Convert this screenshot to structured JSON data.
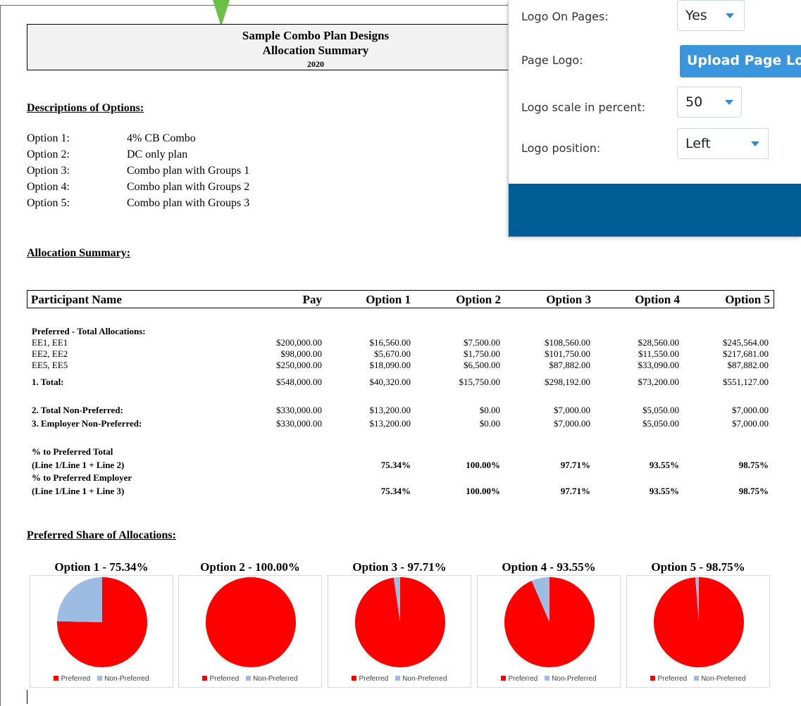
{
  "header": {
    "title": "Sample Combo Plan Designs",
    "subtitle": "Allocation Summary",
    "year": "2020"
  },
  "descriptions": {
    "heading": "Descriptions of Options:",
    "options": [
      {
        "label": "Option 1:",
        "desc": "4% CB Combo"
      },
      {
        "label": "Option 2:",
        "desc": "DC only plan"
      },
      {
        "label": "Option 3:",
        "desc": "Combo plan with Groups 1"
      },
      {
        "label": "Option 4:",
        "desc": "Combo plan with Groups 2"
      },
      {
        "label": "Option 5:",
        "desc": "Combo plan with Groups 3"
      }
    ]
  },
  "allocation": {
    "heading": "Allocation Summary:",
    "columns": [
      "Participant Name",
      "Pay",
      "Option 1",
      "Option 2",
      "Option 3",
      "Option 4",
      "Option 5"
    ],
    "preferred_label": "Preferred - Total Allocations:",
    "rows": [
      {
        "name": "EE1, EE1",
        "values": [
          "$200,000.00",
          "$16,560.00",
          "$7,500.00",
          "$108,560.00",
          "$28,560.00",
          "$245,564.00"
        ]
      },
      {
        "name": "EE2, EE2",
        "values": [
          "$98,000.00",
          "$5,670.00",
          "$1,750.00",
          "$101,750.00",
          "$11,550.00",
          "$217,681.00"
        ]
      },
      {
        "name": "EE5, EE5",
        "values": [
          "$250,000.00",
          "$18,090.00",
          "$6,500.00",
          "$87,882.00",
          "$33,090.00",
          "$87,882.00"
        ]
      },
      {
        "name": "1. Total:",
        "values": [
          "$548,000.00",
          "$40,320.00",
          "$15,750.00",
          "$298,192.00",
          "$73,200.00",
          "$551,127.00"
        ]
      },
      {
        "name": "2. Total Non-Preferred:",
        "values": [
          "$330,000.00",
          "$13,200.00",
          "$0.00",
          "$7,000.00",
          "$5,050.00",
          "$7,000.00"
        ]
      },
      {
        "name": "3. Employer Non-Preferred:",
        "values": [
          "$330,000.00",
          "$13,200.00",
          "$0.00",
          "$7,000.00",
          "$5,050.00",
          "$7,000.00"
        ]
      }
    ],
    "pct_total_label1": "% to Preferred Total",
    "pct_total_label2": "(Line 1/Line 1 + Line 2)",
    "pct_total_values": [
      "75.34%",
      "100.00%",
      "97.71%",
      "93.55%",
      "98.75%"
    ],
    "pct_employer_label1": "% to Preferred Employer",
    "pct_employer_label2": "(Line 1/Line 1 + Line 3)",
    "pct_employer_values": [
      "75.34%",
      "100.00%",
      "97.71%",
      "93.55%",
      "98.75%"
    ]
  },
  "share": {
    "heading": "Preferred Share of Allocations:"
  },
  "chart_data": [
    {
      "type": "pie",
      "title": "Option 1 - 75.34%",
      "labels": [
        "Preferred",
        "Non-Preferred"
      ],
      "values": [
        75.34,
        24.66
      ],
      "colors": [
        "#ff0000",
        "#9dbbe3"
      ]
    },
    {
      "type": "pie",
      "title": "Option 2 - 100.00%",
      "labels": [
        "Preferred",
        "Non-Preferred"
      ],
      "values": [
        100.0,
        0.0
      ],
      "colors": [
        "#ff0000",
        "#9dbbe3"
      ]
    },
    {
      "type": "pie",
      "title": "Option 3 - 97.71%",
      "labels": [
        "Preferred",
        "Non-Preferred"
      ],
      "values": [
        97.71,
        2.29
      ],
      "colors": [
        "#ff0000",
        "#9dbbe3"
      ]
    },
    {
      "type": "pie",
      "title": "Option 4 - 93.55%",
      "labels": [
        "Preferred",
        "Non-Preferred"
      ],
      "values": [
        93.55,
        6.45
      ],
      "colors": [
        "#ff0000",
        "#9dbbe3"
      ]
    },
    {
      "type": "pie",
      "title": "Option 5 - 98.75%",
      "labels": [
        "Preferred",
        "Non-Preferred"
      ],
      "values": [
        98.75,
        1.25
      ],
      "colors": [
        "#ff0000",
        "#9dbbe3"
      ]
    }
  ],
  "settings": {
    "logo_on_pages_label": "Logo On Pages:",
    "logo_on_pages_value": "Yes",
    "page_logo_label": "Page Logo:",
    "upload_button": "Upload Page Lo",
    "logo_scale_label": "Logo scale in percent:",
    "logo_scale_value": "50",
    "logo_position_label": "Logo position:",
    "logo_position_value": "Left",
    "accent_color": "#3b95dc",
    "footer_color": "#005d96"
  }
}
